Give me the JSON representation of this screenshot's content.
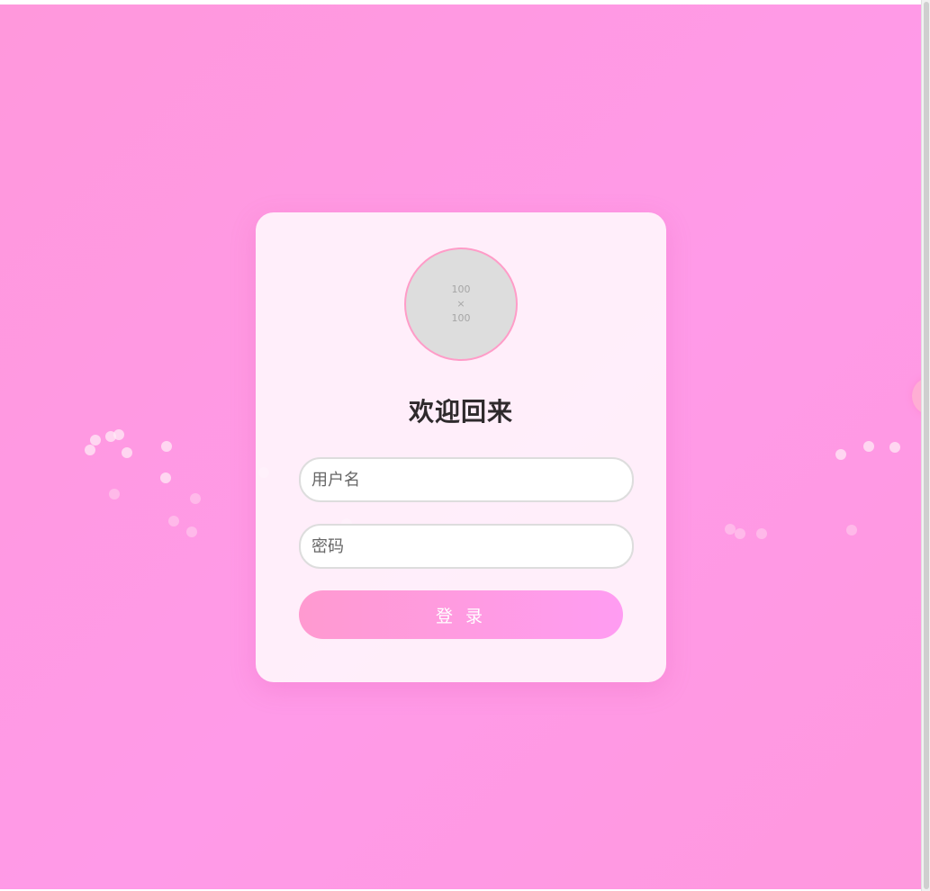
{
  "login": {
    "avatar_placeholder": "100\n×\n100",
    "title": "欢迎回来",
    "username_placeholder": "用户名",
    "password_placeholder": "密码",
    "submit_label": "登 录"
  },
  "side_widget": {
    "glyph": "$"
  },
  "colors": {
    "background_start": "#ff98dc",
    "background_end": "#ff9ae8",
    "card": "#fff5fc",
    "button_start": "#ff9ad0",
    "button_end": "#ff9cf2",
    "avatar_border": "#ff9cc8"
  }
}
